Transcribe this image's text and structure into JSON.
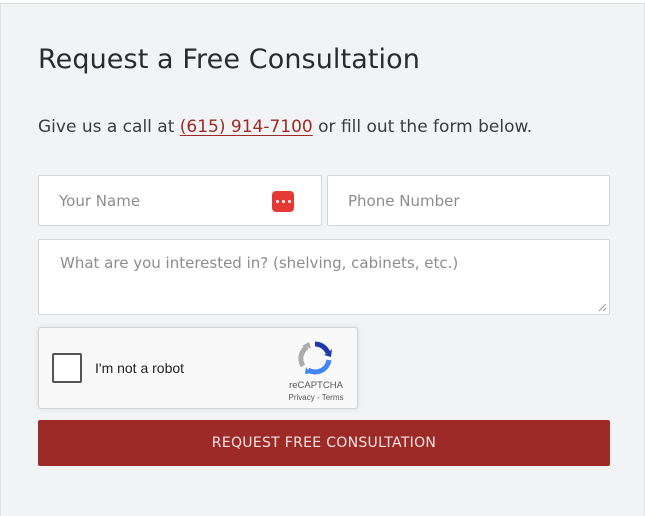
{
  "form": {
    "title": "Request a Free Consultation",
    "intro_before": "Give us a call at ",
    "phone": "(615) 914-7100",
    "intro_after": " or fill out the form below.",
    "name_placeholder": "Your Name",
    "phone_placeholder": "Phone Number",
    "interest_placeholder": "What are you interested in? (shelving, cabinets, etc.)",
    "submit_label": "REQUEST FREE CONSULTATION"
  },
  "recaptcha": {
    "label": "I'm not a robot",
    "brand": "reCAPTCHA",
    "privacy": "Privacy",
    "separator": " - ",
    "terms": "Terms"
  },
  "icons": {
    "password_manager": "password-manager-icon",
    "recaptcha_logo": "recaptcha-logo-icon",
    "resize_grip": "resize-grip-icon"
  },
  "colors": {
    "accent": "#9e2a27",
    "phone_link": "#9e2a24",
    "panel_bg": "#f2f3f5",
    "password_icon": "#e53935"
  }
}
